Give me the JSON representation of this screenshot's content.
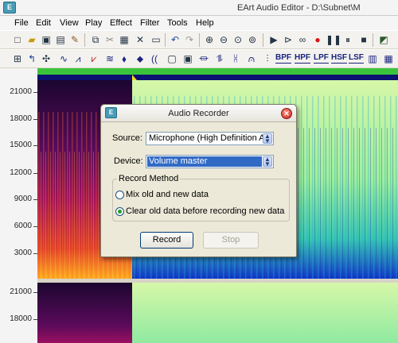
{
  "app": {
    "title": "EArt Audio Editor - D:\\Subnet\\M",
    "icon": "app-icon"
  },
  "menu": [
    "File",
    "Edit",
    "View",
    "Play",
    "Effect",
    "Filter",
    "Tools",
    "Help"
  ],
  "toolbar2_filters": [
    "BPF",
    "HPF",
    "LPF",
    "HSF",
    "LSF"
  ],
  "ruler": {
    "top_labels": [
      "21000",
      "18000",
      "15000",
      "12000",
      "9000",
      "6000",
      "3000"
    ],
    "bottom_labels": [
      "21000",
      "18000"
    ]
  },
  "dialog": {
    "title": "Audio Recorder",
    "source_label": "Source:",
    "source_value": "Microphone (High Definition Au",
    "device_label": "Device:",
    "device_value": "Volume master",
    "group_label": "Record Method",
    "option_mix": "Mix old and new data",
    "option_clear": "Clear old data before recording new data",
    "selected_option": "clear",
    "record_button": "Record",
    "stop_button": "Stop"
  },
  "colors": {
    "selection_bar": "#3bc43b",
    "timeline": "#0c1270",
    "dialog_bg": "#ece9d8",
    "device_highlight": "#316ac5"
  }
}
